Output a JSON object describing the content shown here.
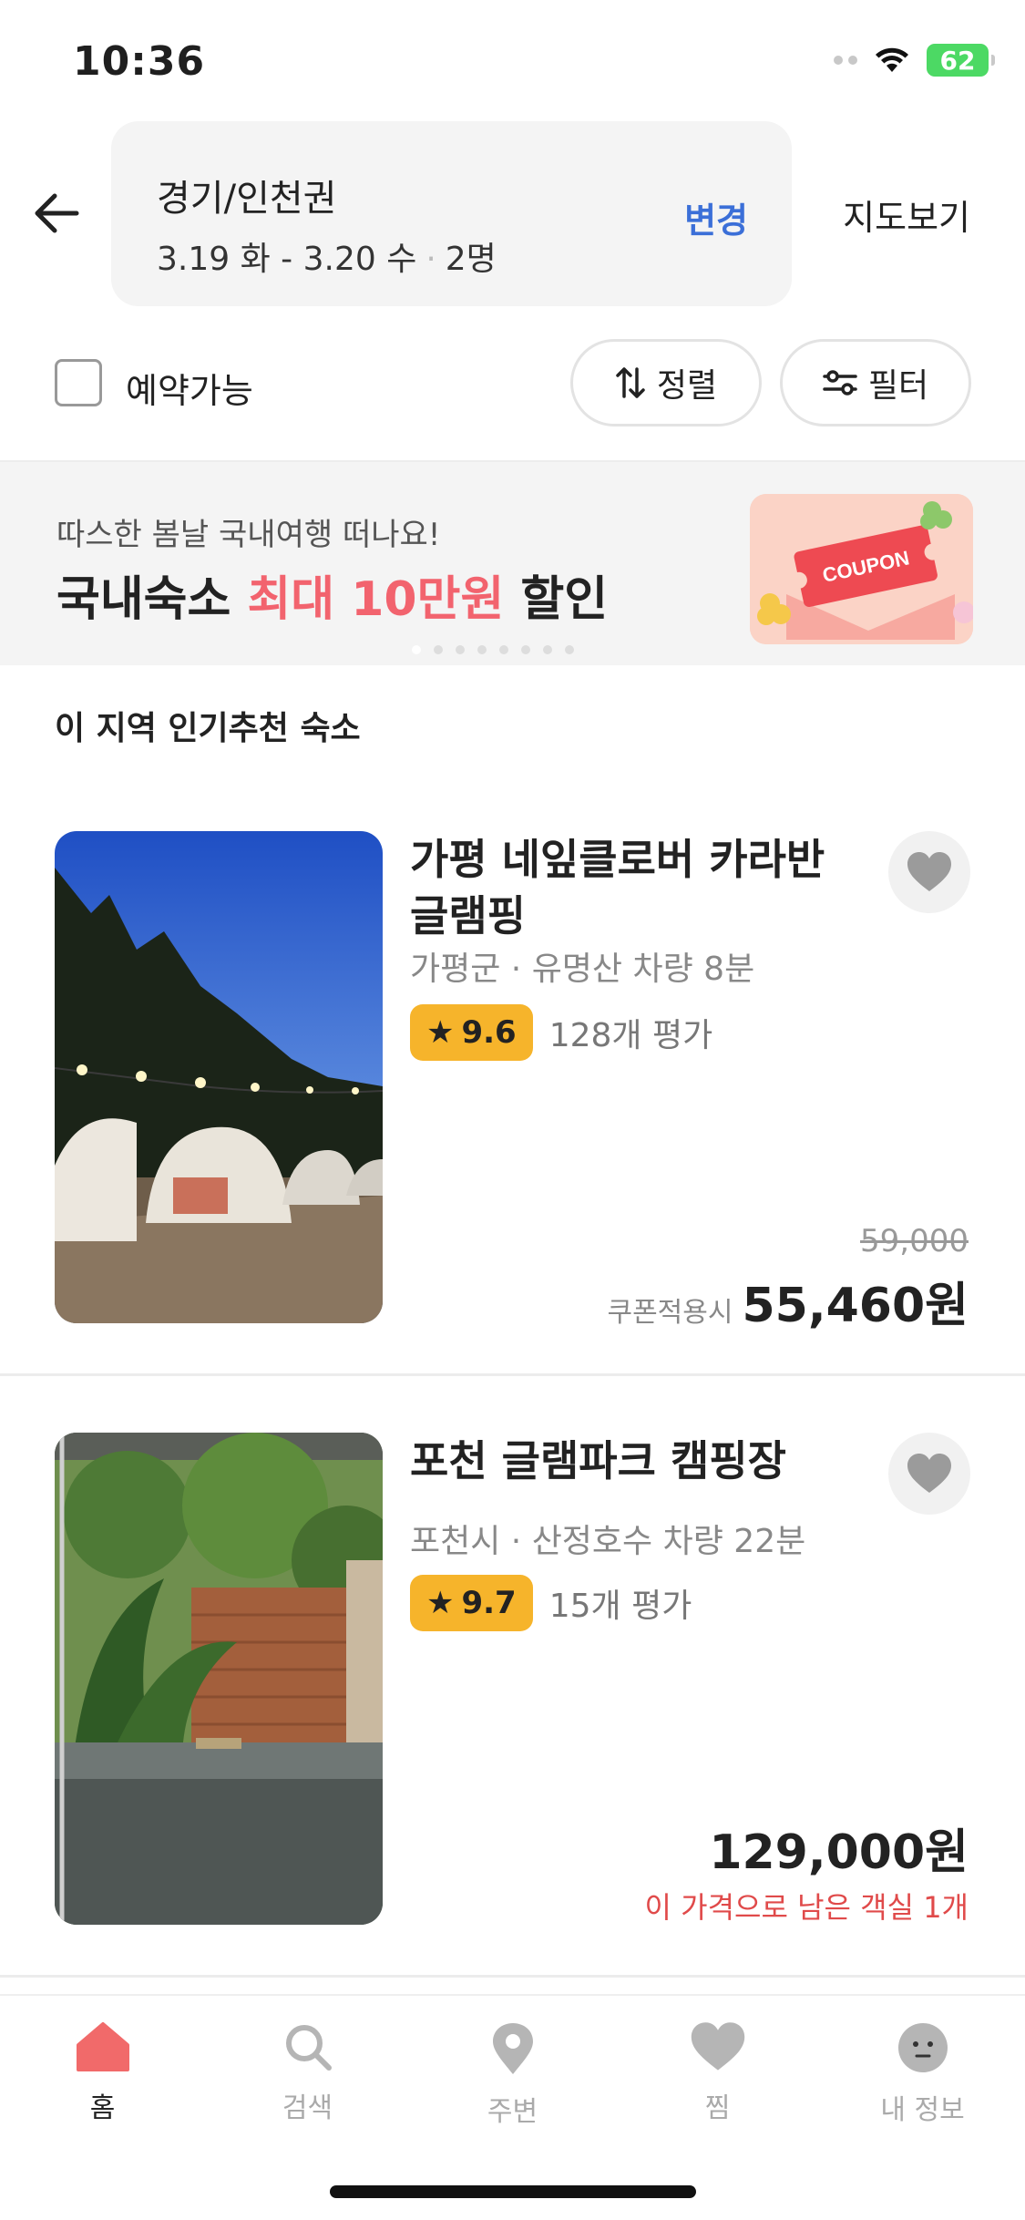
{
  "status": {
    "time": "10:36",
    "battery": "62"
  },
  "header": {
    "region": "경기/인천권",
    "dates": "3.19 화 - 3.20 수",
    "guests": "2명",
    "change_label": "변경",
    "map_label": "지도보기"
  },
  "filters": {
    "available_label": "예약가능",
    "sort_label": "정렬",
    "filter_label": "필터"
  },
  "banner": {
    "subtitle": "따스한 봄날 국내여행 떠나요!",
    "title_pre": "국내숙소 ",
    "title_highlight": "최대 10만원",
    "title_post": " 할인",
    "coupon_text": "COUPON",
    "page_count": 8,
    "active_page": 1
  },
  "section_title": "이 지역 인기추천 숙소",
  "listings": [
    {
      "name": "가평 네잎클로버 카라반 글램핑",
      "location": "가평군 · 유명산 차량 8분",
      "rating": "9.6",
      "review_count": "128개 평가",
      "original_price": "59,000",
      "price_label": "쿠폰적용시",
      "price": "55,460원"
    },
    {
      "name": "포천 글램파크 캠핑장",
      "location": "포천시 · 산정호수 차량 22분",
      "rating": "9.7",
      "review_count": "15개 평가",
      "price": "129,000원",
      "remaining": "이 가격으로 남은 객실 1개"
    }
  ],
  "tabbar": {
    "tabs": [
      {
        "label": "홈",
        "icon": "home-icon"
      },
      {
        "label": "검색",
        "icon": "search-icon"
      },
      {
        "label": "주변",
        "icon": "location-pin-icon"
      },
      {
        "label": "찜",
        "icon": "heart-icon"
      },
      {
        "label": "내 정보",
        "icon": "profile-icon"
      }
    ],
    "active": 0
  },
  "colors": {
    "accent_blue": "#3b6fd8",
    "highlight_red": "#f2636e",
    "rating_yellow": "#f6b42b",
    "home_active": "#f16a6a",
    "battery_green": "#4cd964"
  }
}
